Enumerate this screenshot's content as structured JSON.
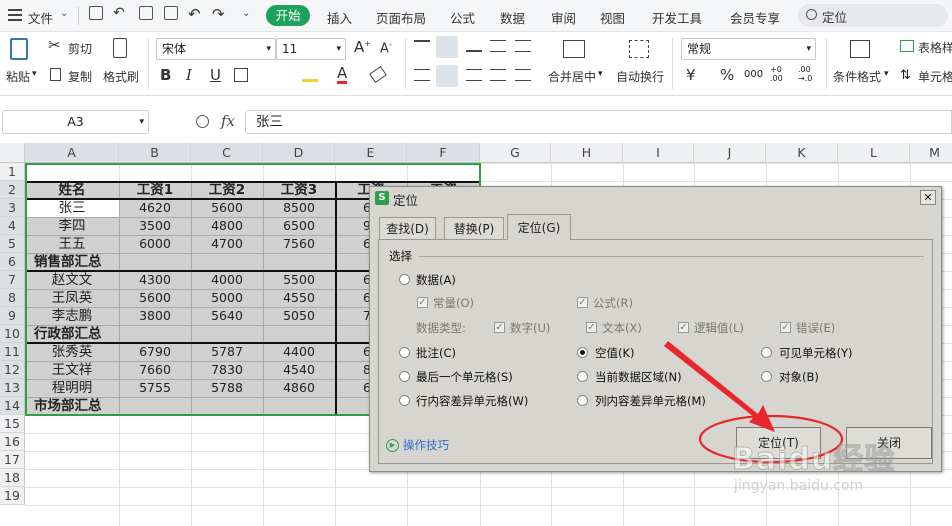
{
  "menubar": {
    "file": "文件",
    "tabs": [
      "开始",
      "插入",
      "页面布局",
      "公式",
      "数据",
      "审阅",
      "视图",
      "开发工具",
      "会员专享"
    ],
    "active_tab": "开始",
    "search": "定位",
    "accent": "#1ba35b"
  },
  "ribbon": {
    "paste": "粘贴",
    "cut": "剪切",
    "copy": "复制",
    "format_painter": "格式刷",
    "font_name": "宋体",
    "font_size": "11",
    "merge": "合并居中",
    "wrap": "自动换行",
    "number_format": "常规",
    "cond_format": "条件格式",
    "table_style": "表格样",
    "cell": "单元格",
    "font_btns": [
      "B",
      "I",
      "U"
    ],
    "pct": "%",
    "yen": "¥"
  },
  "formula": {
    "name_box": "A3",
    "fx": "fx",
    "value": "张三"
  },
  "sheet": {
    "columns": [
      "A",
      "B",
      "C",
      "D",
      "E",
      "F",
      "G",
      "H",
      "I",
      "J",
      "K",
      "L",
      "M"
    ],
    "rows": [
      "1",
      "2",
      "3",
      "4",
      "5",
      "6",
      "7",
      "8",
      "9",
      "10",
      "11",
      "12",
      "13",
      "14",
      "15",
      "16",
      "17",
      "18",
      "19"
    ],
    "header": [
      "姓名",
      "工资1",
      "工资2",
      "工资3",
      "工资",
      "工资"
    ],
    "data": [
      [
        "张三",
        "4620",
        "5600",
        "8500",
        "68"
      ],
      [
        "李四",
        "3500",
        "4800",
        "6500",
        "97"
      ],
      [
        "王五",
        "6000",
        "4700",
        "7560",
        "65"
      ],
      [
        "销售部汇总",
        "",
        "",
        "",
        ""
      ],
      [
        "赵文文",
        "4300",
        "4000",
        "5500",
        "65"
      ],
      [
        "王凤英",
        "5600",
        "5000",
        "4550",
        "65"
      ],
      [
        "李志鹏",
        "3800",
        "5640",
        "5050",
        "78"
      ],
      [
        "行政部汇总",
        "",
        "",
        "",
        ""
      ],
      [
        "张秀英",
        "6790",
        "5787",
        "4400",
        "68"
      ],
      [
        "王文祥",
        "7660",
        "7830",
        "4540",
        "88"
      ],
      [
        "程明明",
        "5755",
        "5788",
        "4860",
        "60"
      ],
      [
        "市场部汇总",
        "",
        "",
        "",
        ""
      ]
    ]
  },
  "dialog": {
    "title": "定位",
    "tabs": [
      "查找(D)",
      "替换(P)",
      "定位(G)"
    ],
    "section": "选择",
    "opt_data": "数据(A)",
    "opt_const": "常量(O)",
    "opt_formula": "公式(R)",
    "type_label": "数据类型:",
    "types": [
      "数字(U)",
      "文本(X)",
      "逻辑值(L)",
      "错误(E)"
    ],
    "opt_comment": "批注(C)",
    "opt_blank": "空值(K)",
    "opt_visible": "可见单元格(Y)",
    "opt_last": "最后一个单元格(S)",
    "opt_region": "当前数据区域(N)",
    "opt_object": "对象(B)",
    "opt_rowdiff": "行内容差异单元格(W)",
    "opt_coldiff": "列内容差异单元格(M)",
    "tips": "操作技巧",
    "ok": "定位(T)",
    "close": "关闭"
  },
  "watermark": {
    "brand": "Baidu经验",
    "url": "jingyan.baidu.com"
  },
  "colors": {
    "selection_green": "#2e9e48",
    "annotation_red": "#e8262b"
  }
}
